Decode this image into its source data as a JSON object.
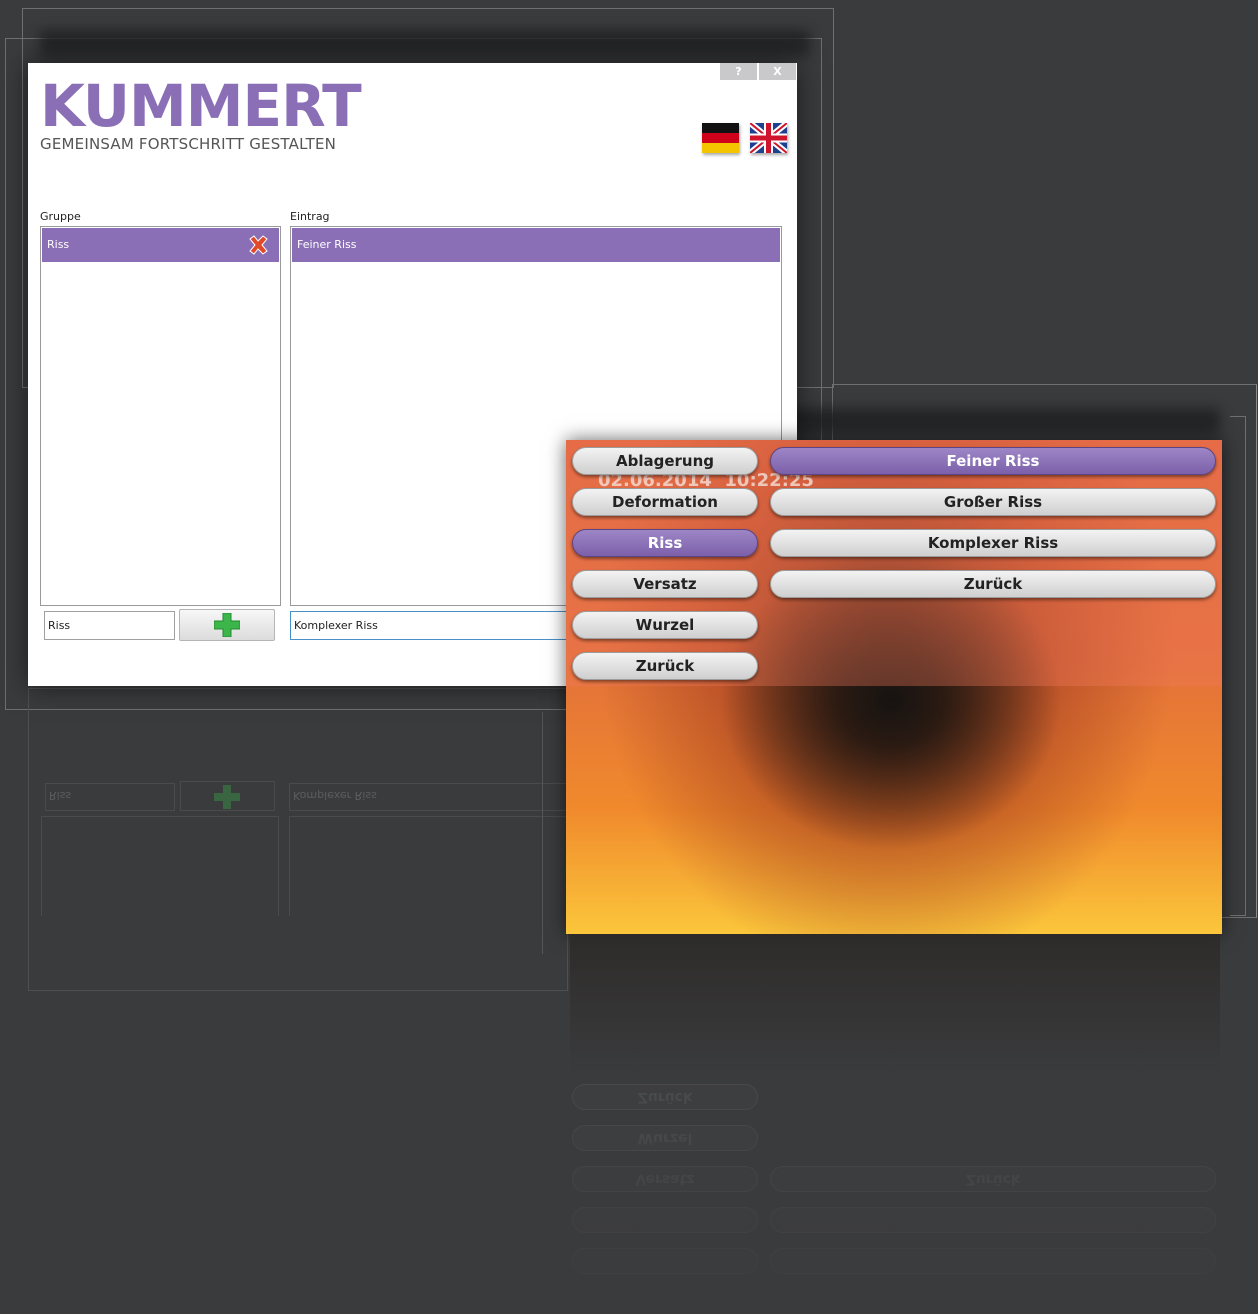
{
  "dialog": {
    "window_buttons": {
      "help": "?",
      "close": "X"
    },
    "logo": {
      "word": "KUMMERT",
      "tagline": "GEMEINSAM FORTSCHRITT GESTALTEN"
    },
    "languages": [
      "Deutsch",
      "English"
    ],
    "group": {
      "label": "Gruppe",
      "items": [
        "Riss"
      ],
      "input_value": "Riss"
    },
    "entry": {
      "label": "Eintrag",
      "items": [
        "Feiner Riss"
      ],
      "input_value": "Komplexer Riss"
    }
  },
  "touch_panel": {
    "groups": [
      "Ablagerung",
      "Deformation",
      "Riss",
      "Versatz",
      "Wurzel",
      "Zurück"
    ],
    "selected_group": "Riss",
    "entries": [
      "Feiner Riss",
      "Großer Riss",
      "Komplexer Riss",
      "Zurück"
    ],
    "selected_entry": "Feiner Riss"
  },
  "colors": {
    "accent_purple": "#8b6fb6",
    "background": "#3a3b3d",
    "delete_red": "#e04a2a",
    "add_green": "#3cb54a"
  },
  "icons": [
    "delete-icon",
    "add-icon",
    "flag-de-icon",
    "flag-uk-icon"
  ]
}
